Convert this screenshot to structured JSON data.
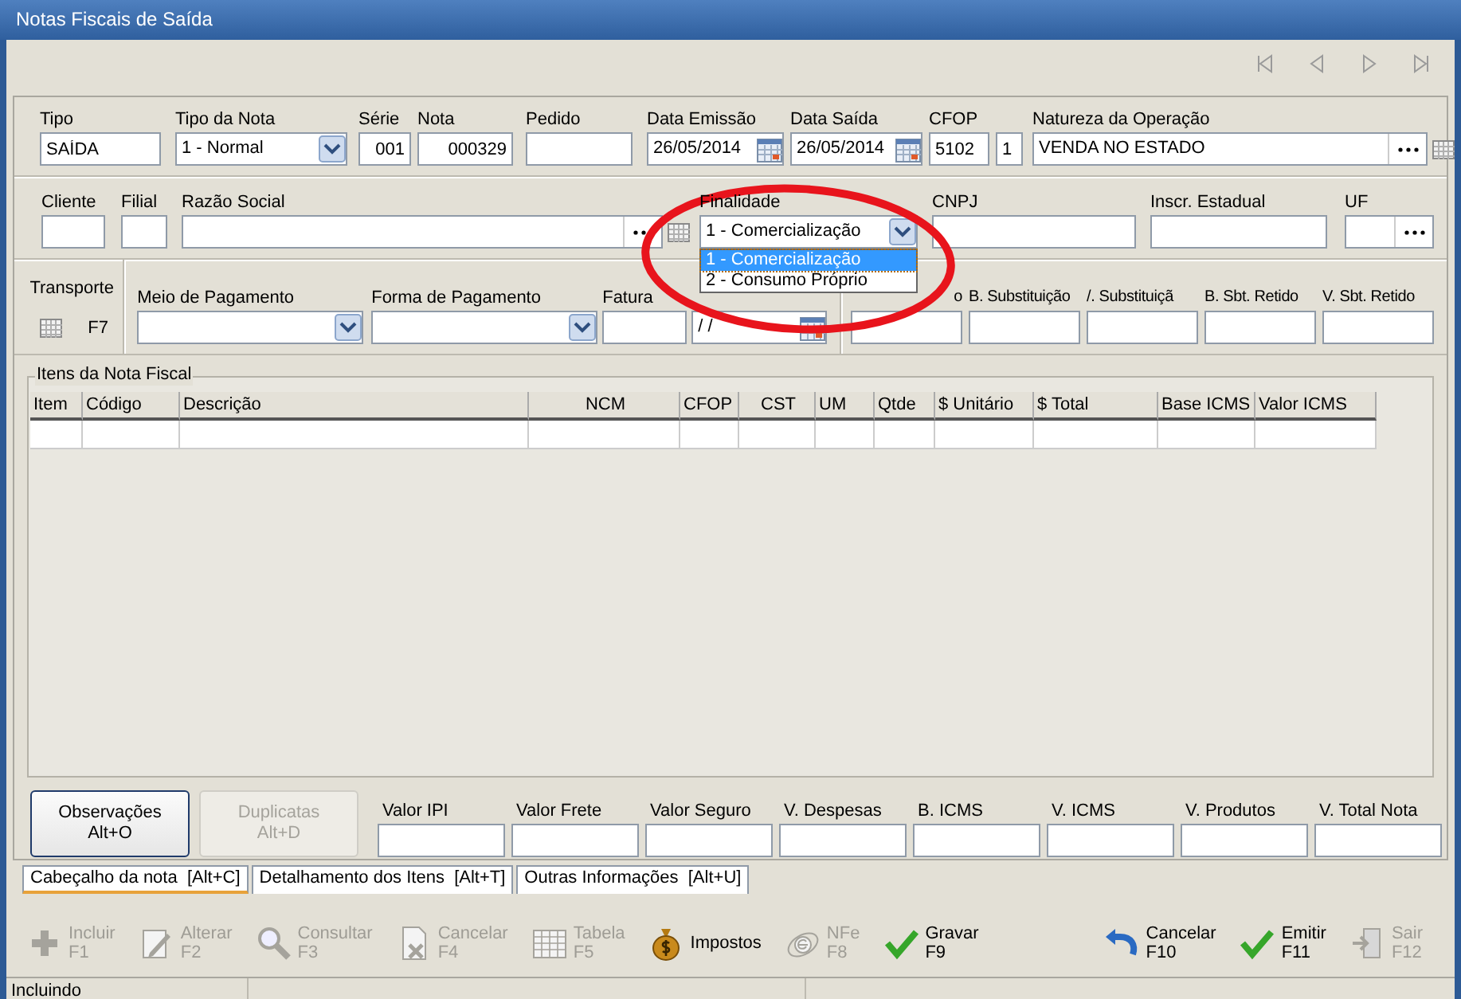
{
  "window": {
    "title": "Notas Fiscais de Saída"
  },
  "header_fields": [
    {
      "label": "Tipo",
      "value": "SAÍDA",
      "kind": "text"
    },
    {
      "label": "Tipo da Nota",
      "value": "1 - Normal",
      "kind": "combo"
    },
    {
      "label": "Série",
      "value": "001",
      "kind": "number"
    },
    {
      "label": "Nota",
      "value": "000329",
      "kind": "number"
    },
    {
      "label": "Pedido",
      "kind": "text"
    },
    {
      "label": "Data Emissão",
      "value": "26/05/2014",
      "kind": "date"
    },
    {
      "label": "Data Saída",
      "value": "26/05/2014",
      "kind": "date"
    },
    {
      "label": "CFOP",
      "value": "5102",
      "kind": "text"
    },
    {
      "value": "1",
      "kind": "text"
    },
    {
      "label": "Natureza da Operação",
      "value": "VENDA NO ESTADO",
      "kind": "lookup-grid"
    }
  ],
  "client_fields": [
    {
      "label": "Cliente",
      "kind": "text"
    },
    {
      "label": "Filial",
      "kind": "text"
    },
    {
      "label": "Razão Social",
      "kind": "lookup-grid"
    },
    {
      "label": "Finalidade",
      "value": "1 - Comercialização",
      "kind": "combo",
      "expanded": true,
      "options": [
        {
          "label": "1 - Comercialização",
          "selected": true
        },
        {
          "label": "2 - Consumo Próprio",
          "selected": false
        }
      ]
    },
    {
      "label": "CNPJ",
      "kind": "text"
    },
    {
      "label": "Inscr. Estadual",
      "kind": "text"
    },
    {
      "label": "UF",
      "kind": "lookup"
    }
  ],
  "transporte": {
    "label": "Transporte",
    "key": "F7"
  },
  "payment_fields": [
    {
      "label": "Meio de Pagamento",
      "kind": "combo"
    },
    {
      "label": "Forma de Pagamento",
      "kind": "combo"
    },
    {
      "label": "Fatura",
      "kind": "text"
    },
    {
      "value": "/ /",
      "kind": "date"
    }
  ],
  "substitution_fields": [
    {
      "label": "o",
      "kind": "text"
    },
    {
      "label": "B. Substituição",
      "kind": "text"
    },
    {
      "label": "/. Substituiçã",
      "kind": "text"
    },
    {
      "label": "B. Sbt. Retido",
      "kind": "text"
    },
    {
      "label": "V. Sbt. Retido",
      "kind": "text"
    }
  ],
  "items_table": {
    "title": "Itens da Nota Fiscal",
    "columns": [
      "Item",
      "Código",
      "Descrição",
      "NCM",
      "CFOP",
      "CST",
      "UM",
      "Qtde",
      "$ Unitário",
      "$ Total",
      "Base ICMS",
      "Valor ICMS"
    ]
  },
  "action_buttons": [
    {
      "label": "Observações",
      "shortcut": "Alt+O",
      "disabled": false
    },
    {
      "label": "Duplicatas",
      "shortcut": "Alt+D",
      "disabled": true
    }
  ],
  "totals": [
    "Valor IPI",
    "Valor Frete",
    "Valor Seguro",
    "V. Despesas",
    "B. ICMS",
    "V. ICMS",
    "V. Produtos",
    "V. Total Nota"
  ],
  "tabs": [
    {
      "label": "Cabeçalho da nota  [Alt+C]",
      "selected": true
    },
    {
      "label": "Detalhamento dos Itens  [Alt+T]",
      "selected": false
    },
    {
      "label": "Outras Informações  [Alt+U]",
      "selected": false
    }
  ],
  "toolbar_left": [
    {
      "label": "Incluir",
      "key": "F1",
      "kind": "plus",
      "disabled": true
    },
    {
      "label": "Alterar",
      "key": "F2",
      "kind": "pencil",
      "disabled": true
    },
    {
      "label": "Consultar",
      "key": "F3",
      "kind": "magnifier",
      "disabled": true
    },
    {
      "label": "Cancelar",
      "key": "F4",
      "kind": "document",
      "disabled": true
    },
    {
      "label": "Tabela",
      "key": "F5",
      "kind": "table",
      "disabled": true
    },
    {
      "label": "Impostos",
      "kind": "moneybag",
      "disabled": false
    },
    {
      "label": "NFe",
      "key": "F8",
      "kind": "nfe",
      "disabled": true
    },
    {
      "label": "Gravar",
      "key": "F9",
      "kind": "check",
      "disabled": false
    }
  ],
  "toolbar_right": [
    {
      "label": "Cancelar",
      "key": "F10",
      "kind": "undo",
      "disabled": false
    },
    {
      "label": "Emitir",
      "key": "F11",
      "kind": "check",
      "disabled": false
    },
    {
      "label": "Sair",
      "key": "F12",
      "kind": "exit",
      "disabled": true
    }
  ],
  "status_bar": {
    "text": "Incluindo"
  }
}
